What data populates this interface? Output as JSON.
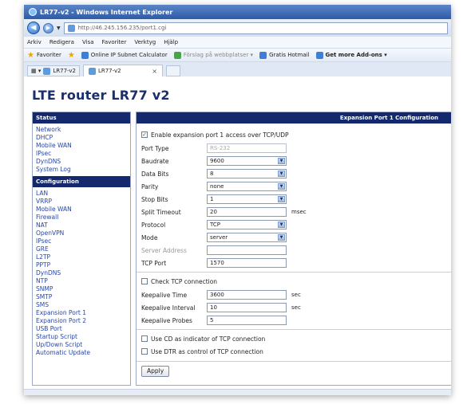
{
  "window": {
    "title": "LR77-v2 - Windows Internet Explorer"
  },
  "address": {
    "url": "http://46.245.156.235/port1.cgi"
  },
  "menubar": {
    "items": [
      "Arkiv",
      "Redigera",
      "Visa",
      "Favoriter",
      "Verktyg",
      "Hjälp"
    ]
  },
  "favorites": {
    "label": "Favoriter",
    "items": [
      {
        "label": "Online IP Subnet Calculator"
      },
      {
        "label": "Förslag på webbplatser ▾"
      },
      {
        "label": "Gratis Hotmail"
      },
      {
        "label": "Get more Add-ons ▾"
      }
    ]
  },
  "tabs": {
    "quick_label": "LR77-v2",
    "active_label": "LR77-v2",
    "close": "×"
  },
  "app": {
    "title": "LTE router LR77 v2"
  },
  "sidebar": {
    "status_header": "Status",
    "status_items": [
      "Network",
      "DHCP",
      "Mobile WAN",
      "IPsec",
      "DynDNS",
      "System Log"
    ],
    "config_header": "Configuration",
    "config_items": [
      "LAN",
      "VRRP",
      "Mobile WAN",
      "Firewall",
      "NAT",
      "OpenVPN",
      "IPsec",
      "GRE",
      "L2TP",
      "PPTP",
      "DynDNS",
      "NTP",
      "SNMP",
      "SMTP",
      "SMS",
      "Expansion Port 1",
      "Expansion Port 2",
      "USB Port",
      "Startup Script",
      "Up/Down Script",
      "Automatic Update"
    ]
  },
  "main": {
    "header": "Expansion Port 1 Configuration",
    "enable_label": "Enable expansion port 1 access over TCP/UDP",
    "enable_checked": true,
    "fields": {
      "port_type": {
        "label": "Port Type",
        "value": "RS-232"
      },
      "baudrate": {
        "label": "Baudrate",
        "value": "9600"
      },
      "data_bits": {
        "label": "Data Bits",
        "value": "8"
      },
      "parity": {
        "label": "Parity",
        "value": "none"
      },
      "stop_bits": {
        "label": "Stop Bits",
        "value": "1"
      },
      "split_timeout": {
        "label": "Split Timeout",
        "value": "20",
        "unit": "msec"
      },
      "protocol": {
        "label": "Protocol",
        "value": "TCP"
      },
      "mode": {
        "label": "Mode",
        "value": "server"
      },
      "server_address": {
        "label": "Server Address",
        "value": ""
      },
      "tcp_port": {
        "label": "TCP Port",
        "value": "1570"
      }
    },
    "check_tcp": {
      "label": "Check TCP connection",
      "checked": false
    },
    "keepalive": {
      "time": {
        "label": "Keepalive Time",
        "value": "3600",
        "unit": "sec"
      },
      "interval": {
        "label": "Keepalive Interval",
        "value": "10",
        "unit": "sec"
      },
      "probes": {
        "label": "Keepalive Probes",
        "value": "5"
      }
    },
    "use_cd": {
      "label": "Use CD as indicator of TCP connection",
      "checked": false
    },
    "use_dtr": {
      "label": "Use DTR as control of TCP connection",
      "checked": false
    },
    "apply_label": "Apply"
  }
}
